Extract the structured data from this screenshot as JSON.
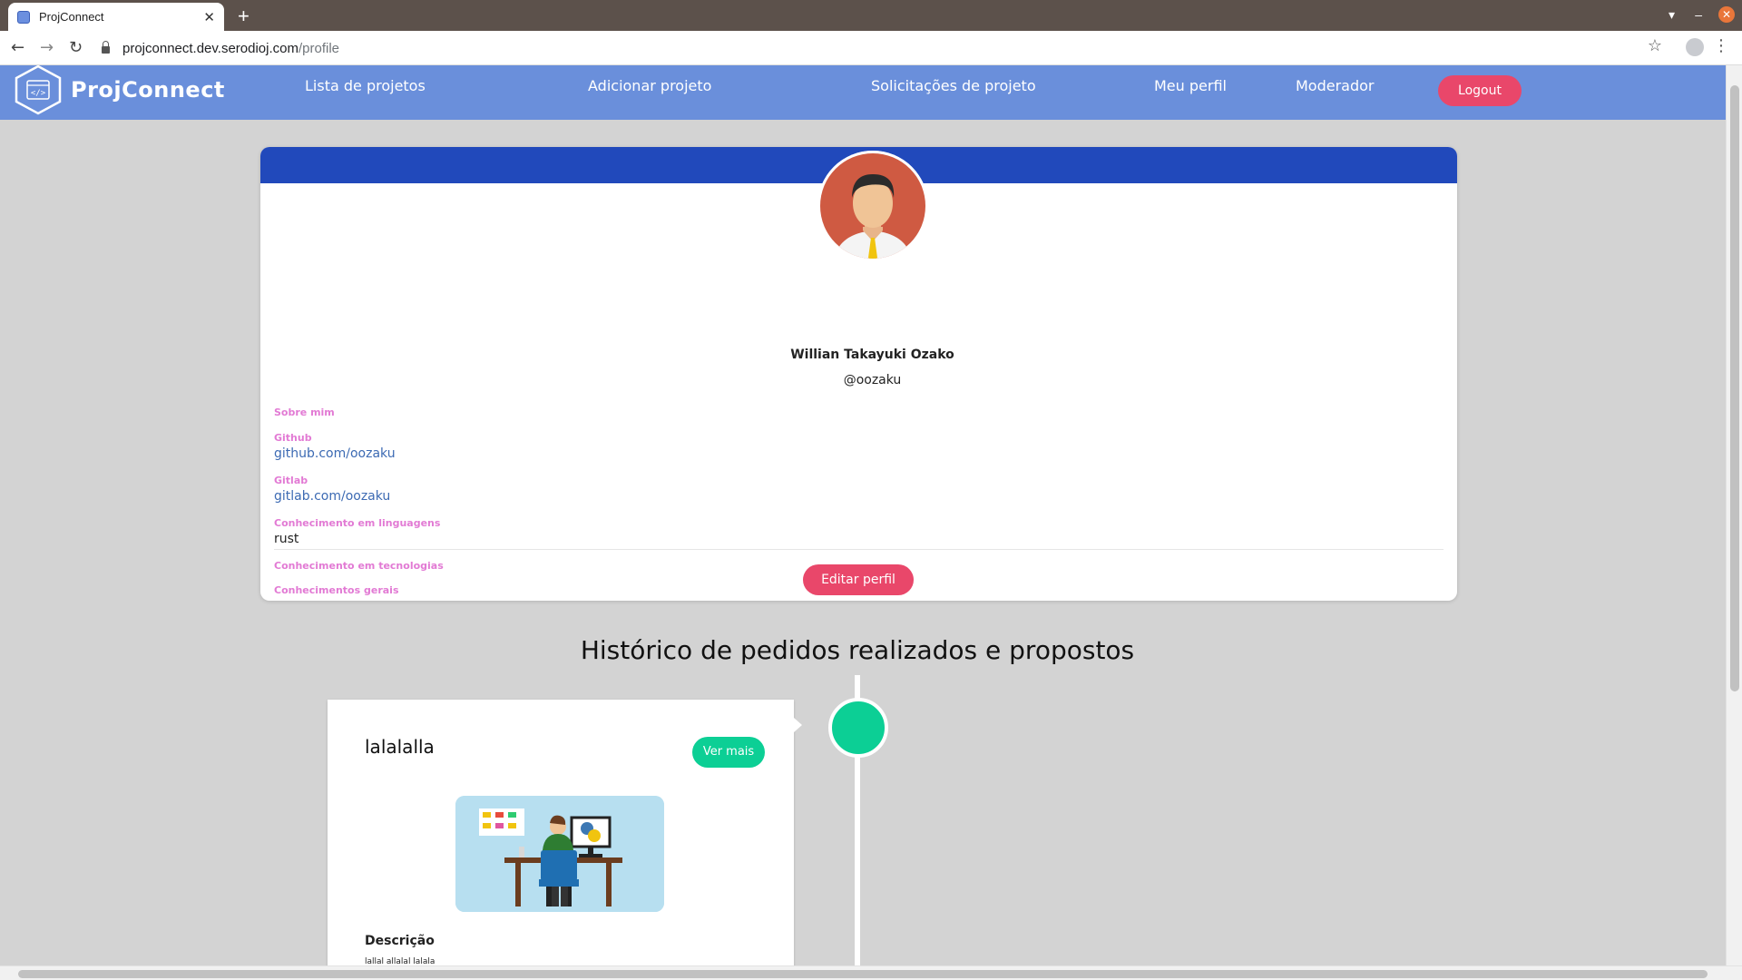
{
  "browser": {
    "tab_title": "ProjConnect",
    "url_host": "projconnect.dev.serodioj.com",
    "url_path": "/profile"
  },
  "app": {
    "brand": "ProjConnect",
    "nav": [
      "Lista de projetos",
      "Adicionar projeto",
      "Solicitações de projeto",
      "Meu perfil",
      "Moderador"
    ],
    "logout_label": "Logout",
    "colors": {
      "navbar": "#6a8fdb",
      "card_header": "#2149bb",
      "primary_pink": "#e9476a",
      "accent_green": "#0ccf95",
      "label_pink": "#e27ad4"
    }
  },
  "profile": {
    "name": "Willian Takayuki Ozako",
    "username": "@oozaku",
    "fields": {
      "about_label": "Sobre mim",
      "github_label": "Github",
      "github_value": "github.com/oozaku",
      "gitlab_label": "Gitlab",
      "gitlab_value": "gitlab.com/oozaku",
      "languages_label": "Conhecimento em linguagens",
      "languages_value": "rust",
      "technologies_label": "Conhecimento em tecnologias",
      "general_label": "Conhecimentos gerais"
    },
    "edit_label": "Editar perfil"
  },
  "history": {
    "title": "Histórico de pedidos realizados e propostos",
    "items": [
      {
        "title": "lalalalla",
        "action_label": "Ver mais",
        "description_label": "Descrição",
        "description": "lallal allalal lalala"
      }
    ]
  }
}
